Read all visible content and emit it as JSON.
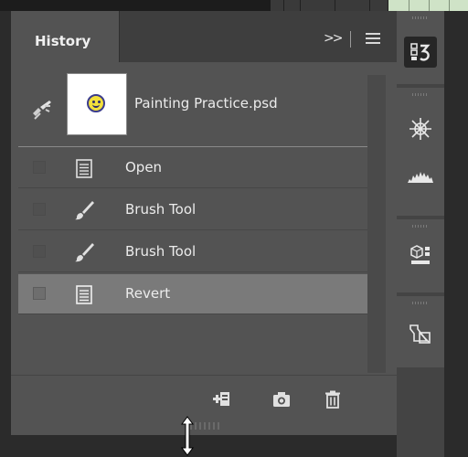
{
  "panel": {
    "tab_label": "History",
    "collapse_icon": "double-chevron-right-icon",
    "menu_icon": "panel-menu-icon"
  },
  "snapshot": {
    "name": "Painting Practice.psd",
    "icon": "history-brush-icon"
  },
  "history_items": [
    {
      "label": "Open",
      "icon": "document-icon",
      "selected": false
    },
    {
      "label": "Brush Tool",
      "icon": "brush-icon",
      "selected": false
    },
    {
      "label": "Brush Tool",
      "icon": "brush-icon",
      "selected": false
    },
    {
      "label": "Revert",
      "icon": "document-icon",
      "selected": true
    }
  ],
  "footer_icons": [
    "new-document-from-state-icon",
    "camera-icon",
    "trash-icon"
  ],
  "dock_icons": [
    "history-icon",
    "brush-settings-icon",
    "histogram-icon",
    "3d-icon",
    "paths-icon"
  ],
  "colors": {
    "panel_bg": "#535353",
    "tab_bar_bg": "#3e3e3e",
    "selected_row": "#7a7a7a",
    "app_bg": "#2b2b2b"
  }
}
